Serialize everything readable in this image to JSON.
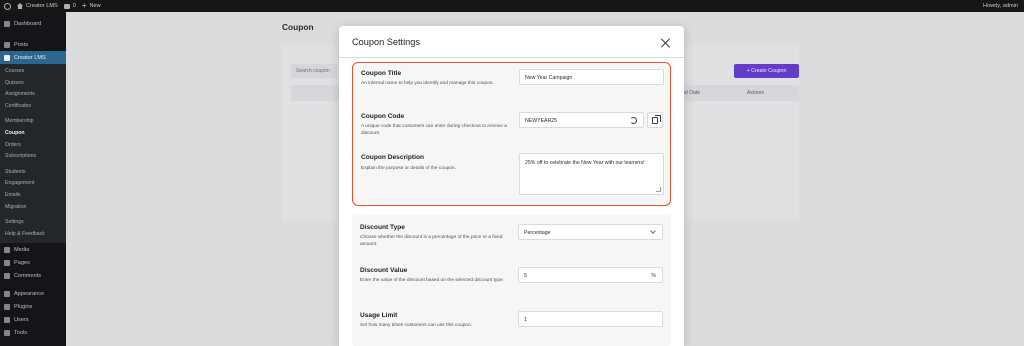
{
  "admin_bar": {
    "site_name": "Creator LMS",
    "comments_count": "0",
    "new_label": "New",
    "howdy": "Howdy, admin"
  },
  "sidebar": {
    "dashboard": "Dashboard",
    "posts": "Posts",
    "creator_lms": "Creator LMS",
    "sub_items": [
      "Courses",
      "Quizzes",
      "Assignments",
      "Certificates",
      "Membership",
      "Coupon",
      "Orders",
      "Subscriptions",
      "Students",
      "Engagement",
      "Emails",
      "Migration",
      "Settings",
      "Help & Feedback"
    ],
    "media": "Media",
    "pages": "Pages",
    "comments": "Comments",
    "appearance": "Appearance",
    "plugins": "Plugins",
    "users": "Users",
    "tools": "Tools"
  },
  "page": {
    "title": "Coupon",
    "search_placeholder": "Search coupon",
    "create_button": "+ Create Coupon",
    "columns": {
      "end_date": "nd Date",
      "actions": "Actions"
    }
  },
  "modal": {
    "title": "Coupon Settings",
    "coupon_title": {
      "label": "Coupon Title",
      "description": "An internal name to help you identify and manage this coupon.",
      "value": "New Year Campaign"
    },
    "coupon_code": {
      "label": "Coupon Code",
      "description": "A unique code that customers can enter during checkout to receive a discount.",
      "value": "NEWYEAR25"
    },
    "coupon_description": {
      "label": "Coupon Description",
      "description": "Explain the purpose or details of the coupon.",
      "value": "25% off to celebrate the New Year with our learners!"
    },
    "discount_type": {
      "label": "Discount Type",
      "description": "Choose whether the discount is a percentage of the price or a fixed amount.",
      "value": "Percentage"
    },
    "discount_value": {
      "label": "Discount Value",
      "description": "Enter the value of the discount based on the selected discount type.",
      "value": "5",
      "unit": "%"
    },
    "usage_limit": {
      "label": "Usage Limit",
      "description": "Set how many times customers can use this coupon.",
      "value": "1"
    }
  },
  "colors": {
    "accent": "#6a40d6",
    "highlight": "#e0552c",
    "sidebar_active": "#2f6d97"
  }
}
